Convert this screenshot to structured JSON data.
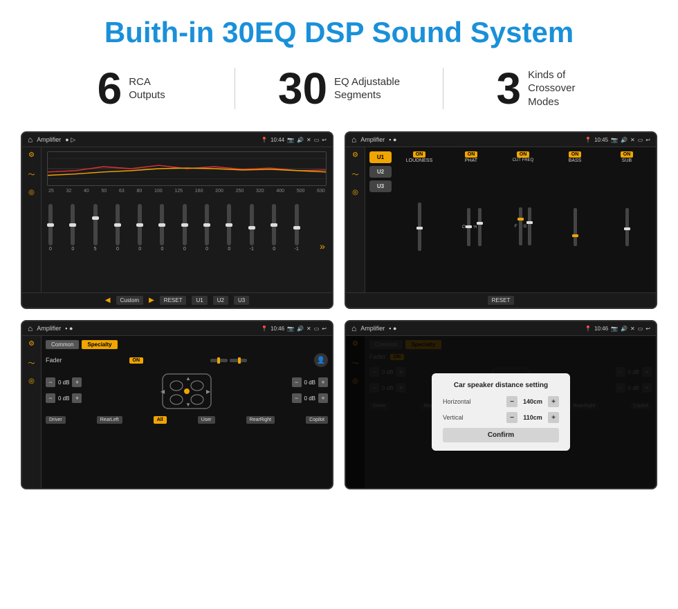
{
  "page": {
    "title": "Buith-in 30EQ DSP Sound System",
    "stats": [
      {
        "number": "6",
        "label": "RCA\nOutputs"
      },
      {
        "number": "30",
        "label": "EQ Adjustable\nSegments"
      },
      {
        "number": "3",
        "label": "Kinds of\nCrossover Modes"
      }
    ]
  },
  "screen1": {
    "status": {
      "app": "Amplifier",
      "time": "10:44"
    },
    "eq_freqs": [
      "25",
      "32",
      "40",
      "50",
      "63",
      "80",
      "100",
      "125",
      "160",
      "200",
      "250",
      "320",
      "400",
      "500",
      "630"
    ],
    "eq_vals": [
      "0",
      "0",
      "0",
      "5",
      "0",
      "0",
      "0",
      "0",
      "0",
      "0",
      "0",
      "-1",
      "0",
      "-1"
    ],
    "buttons": [
      "Custom",
      "RESET",
      "U1",
      "U2",
      "U3"
    ]
  },
  "screen2": {
    "status": {
      "app": "Amplifier",
      "time": "10:45"
    },
    "presets": [
      "U1",
      "U2",
      "U3"
    ],
    "channels": [
      "LOUDNESS",
      "PHAT",
      "CUT FREQ",
      "BASS",
      "SUB"
    ],
    "reset": "RESET"
  },
  "screen3": {
    "status": {
      "app": "Amplifier",
      "time": "10:46"
    },
    "tabs": [
      "Common",
      "Specialty"
    ],
    "fader_label": "Fader",
    "on_toggle": "ON",
    "volumes": [
      {
        "label": "0 dB"
      },
      {
        "label": "0 dB"
      },
      {
        "label": "0 dB"
      },
      {
        "label": "0 dB"
      }
    ],
    "bottom_labels": [
      "Driver",
      "RearLeft",
      "All",
      "User",
      "RearRight",
      "Copilot"
    ]
  },
  "screen4": {
    "status": {
      "app": "Amplifier",
      "time": "10:46"
    },
    "tabs": [
      "Common",
      "Specialty"
    ],
    "on_toggle": "ON",
    "dialog": {
      "title": "Car speaker distance setting",
      "horizontal_label": "Horizontal",
      "horizontal_val": "140cm",
      "vertical_label": "Vertical",
      "vertical_val": "110cm",
      "confirm_label": "Confirm"
    },
    "volumes": [
      {
        "label": "0 dB"
      },
      {
        "label": "0 dB"
      }
    ],
    "bottom_labels": [
      "Driver",
      "RearLeft",
      "All",
      "User",
      "RearRight",
      "Copilot"
    ]
  }
}
